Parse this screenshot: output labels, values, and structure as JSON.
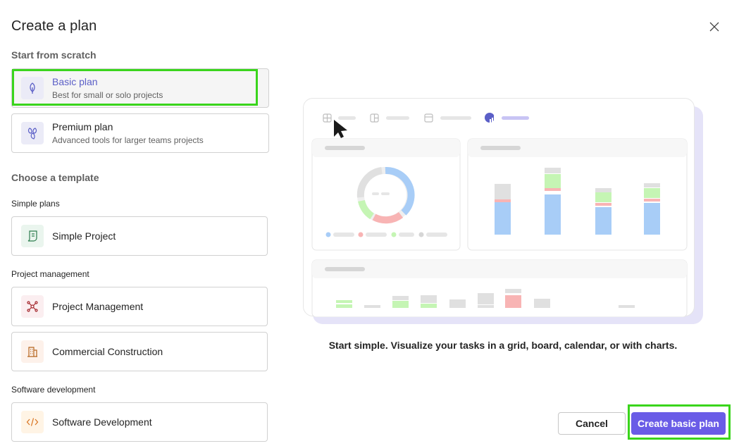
{
  "dialog": {
    "title": "Create a plan",
    "close_icon": "close-icon"
  },
  "scratch": {
    "heading": "Start from scratch",
    "basic": {
      "name": "Basic plan",
      "desc": "Best for small or solo projects",
      "icon": "leaf-icon"
    },
    "premium": {
      "name": "Premium plan",
      "desc": "Advanced tools for larger teams projects",
      "icon": "premium-leaves-icon"
    }
  },
  "templates": {
    "heading": "Choose a template",
    "simple_group": "Simple plans",
    "simple_project": "Simple Project",
    "pm_group": "Project management",
    "project_management": "Project Management",
    "commercial_construction": "Commercial Construction",
    "sw_group": "Software development",
    "software_development": "Software Development"
  },
  "preview": {
    "caption": "Start simple. Visualize your tasks in a grid, board, calendar, or with charts."
  },
  "footer": {
    "cancel_label": "Cancel",
    "create_label": "Create basic plan"
  },
  "colors": {
    "accent": "#6a5ce7",
    "selected_text": "#5b5fc7",
    "highlight": "#3ad51c",
    "chart_blue": "#a8cdf7",
    "chart_green": "#c5f5b4",
    "chart_red": "#f8b4b4",
    "chart_gray": "#dedede"
  }
}
